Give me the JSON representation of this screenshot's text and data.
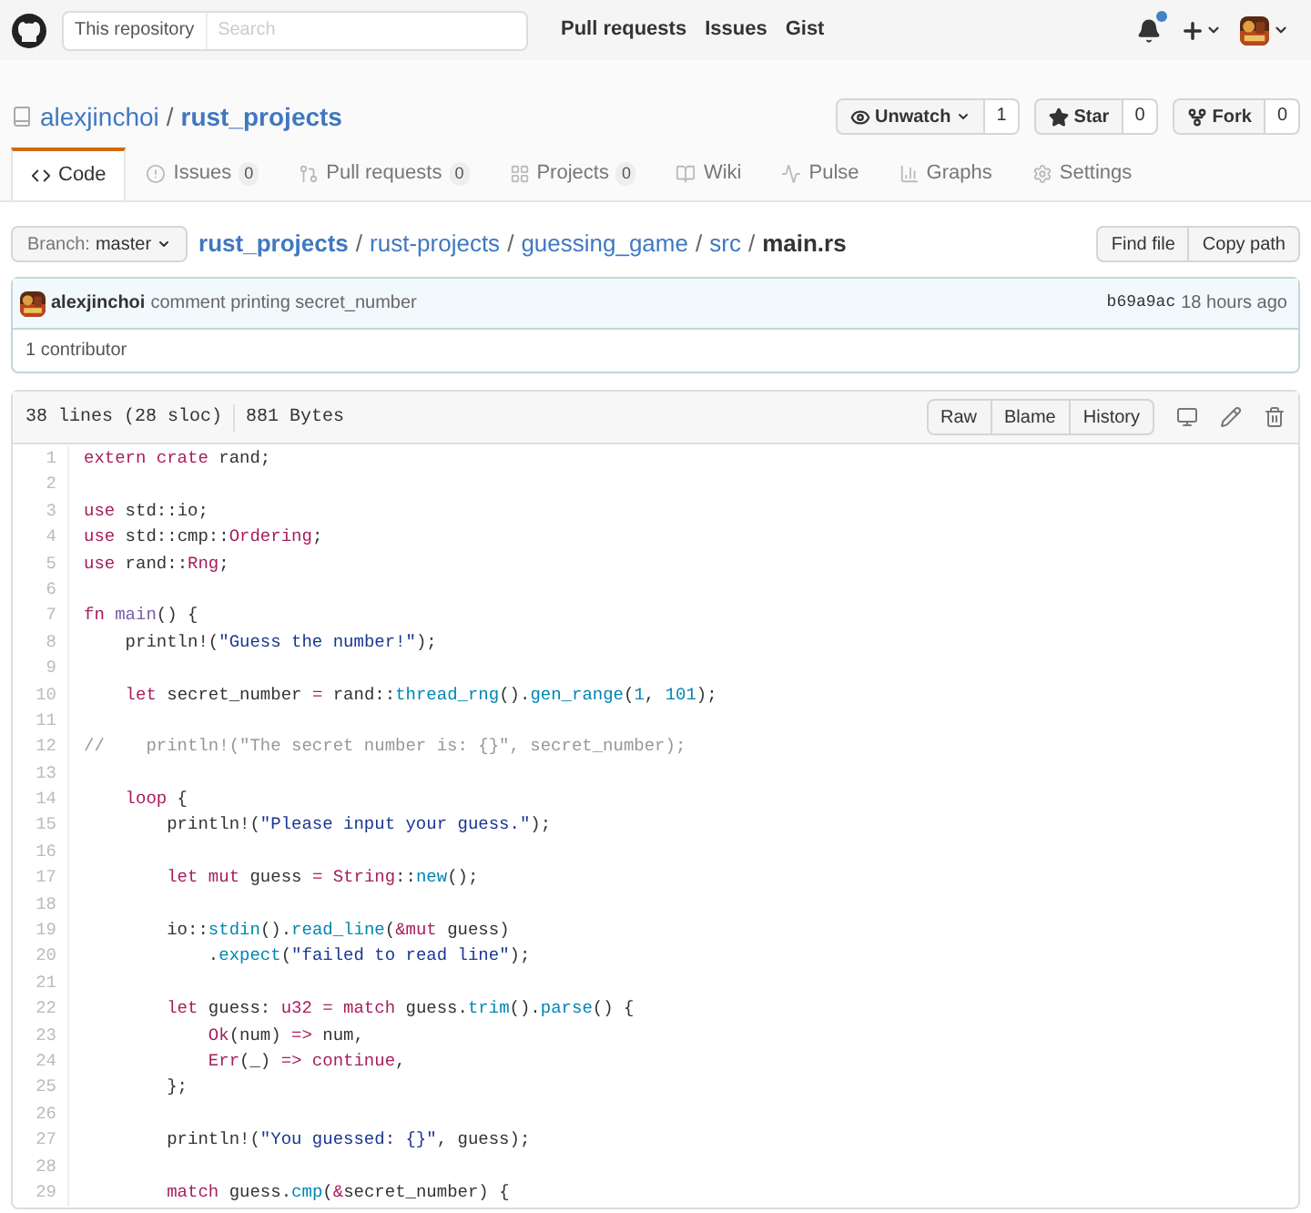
{
  "header": {
    "scope_label": "This repository",
    "search": {
      "placeholder": "Search"
    },
    "nav": [
      "Pull requests",
      "Issues",
      "Gist"
    ],
    "notification_unread": true
  },
  "repo": {
    "owner": "alexjinchoi",
    "separator": "/",
    "name": "rust_projects",
    "actions": [
      {
        "kind": "watch",
        "label": "Unwatch",
        "count": "1"
      },
      {
        "kind": "star",
        "label": "Star",
        "count": "0"
      },
      {
        "kind": "fork",
        "label": "Fork",
        "count": "0"
      }
    ]
  },
  "tabs": [
    {
      "kind": "code",
      "label": "Code",
      "selected": true
    },
    {
      "kind": "issues",
      "label": "Issues",
      "count": "0",
      "selected": false
    },
    {
      "kind": "pulls",
      "label": "Pull requests",
      "count": "0",
      "selected": false
    },
    {
      "kind": "projects",
      "label": "Projects",
      "count": "0",
      "selected": false
    },
    {
      "kind": "wiki",
      "label": "Wiki",
      "selected": false
    },
    {
      "kind": "pulse",
      "label": "Pulse",
      "selected": false
    },
    {
      "kind": "graphs",
      "label": "Graphs",
      "selected": false
    },
    {
      "kind": "settings",
      "label": "Settings",
      "selected": false
    }
  ],
  "branch": {
    "label": "Branch:",
    "value": "master"
  },
  "breadcrumb": [
    "rust_projects",
    "rust-projects",
    "guessing_game",
    "src",
    "main.rs"
  ],
  "breadcrumb_separator": "/",
  "file_actions": [
    "Find file",
    "Copy path"
  ],
  "commit": {
    "author": "alexjinchoi",
    "message": "comment printing secret_number",
    "sha": "b69a9ac",
    "time": "18 hours ago"
  },
  "contributors": "1 contributor",
  "file": {
    "lines_info": "38 lines (28 sloc)",
    "size": "881 Bytes",
    "buttons": [
      "Raw",
      "Blame",
      "History"
    ],
    "lines": [
      {
        "number": "1",
        "segments": [
          {
            "kind": "kw",
            "text": "extern crate"
          },
          {
            "kind": "plain",
            "text": " rand;"
          }
        ]
      },
      {
        "number": "2"
      },
      {
        "number": "3",
        "segments": [
          {
            "kind": "kw",
            "text": "use"
          },
          {
            "kind": "plain",
            "text": " std::io;"
          }
        ]
      },
      {
        "number": "4",
        "segments": [
          {
            "kind": "kw",
            "text": "use"
          },
          {
            "kind": "plain",
            "text": " std::cmp::"
          },
          {
            "kind": "kw",
            "text": "Ordering"
          },
          {
            "kind": "plain",
            "text": ";"
          }
        ]
      },
      {
        "number": "5",
        "segments": [
          {
            "kind": "kw",
            "text": "use"
          },
          {
            "kind": "plain",
            "text": " rand::"
          },
          {
            "kind": "kw",
            "text": "Rng"
          },
          {
            "kind": "plain",
            "text": ";"
          }
        ]
      },
      {
        "number": "6"
      },
      {
        "number": "7",
        "segments": [
          {
            "kind": "kw",
            "text": "fn "
          },
          {
            "kind": "ent",
            "text": "main"
          },
          {
            "kind": "plain",
            "text": "() {"
          }
        ]
      },
      {
        "number": "8",
        "segments": [
          {
            "kind": "plain",
            "text": "    println!("
          },
          {
            "kind": "str",
            "text": "\"Guess the number!\""
          },
          {
            "kind": "plain",
            "text": ");"
          }
        ]
      },
      {
        "number": "9"
      },
      {
        "number": "10",
        "segments": [
          {
            "kind": "kw",
            "text": "    let"
          },
          {
            "kind": "plain",
            "text": " secret_number "
          },
          {
            "kind": "kw",
            "text": "="
          },
          {
            "kind": "plain",
            "text": " rand::"
          },
          {
            "kind": "fn",
            "text": "thread_rng"
          },
          {
            "kind": "plain",
            "text": "()."
          },
          {
            "kind": "fn",
            "text": "gen_range"
          },
          {
            "kind": "plain",
            "text": "("
          },
          {
            "kind": "fn",
            "text": "1"
          },
          {
            "kind": "plain",
            "text": ", "
          },
          {
            "kind": "fn",
            "text": "101"
          },
          {
            "kind": "plain",
            "text": ");"
          }
        ]
      },
      {
        "number": "11"
      },
      {
        "number": "12",
        "segments": [
          {
            "kind": "comment",
            "text": "//    println!(\"The secret number is: {}\", secret_number);"
          }
        ]
      },
      {
        "number": "13"
      },
      {
        "number": "14",
        "segments": [
          {
            "kind": "kw",
            "text": "    loop"
          },
          {
            "kind": "plain",
            "text": " {"
          }
        ]
      },
      {
        "number": "15",
        "segments": [
          {
            "kind": "plain",
            "text": "        println!("
          },
          {
            "kind": "str",
            "text": "\"Please input your guess.\""
          },
          {
            "kind": "plain",
            "text": ");"
          }
        ]
      },
      {
        "number": "16"
      },
      {
        "number": "17",
        "segments": [
          {
            "kind": "kw",
            "text": "        let mut"
          },
          {
            "kind": "plain",
            "text": " guess "
          },
          {
            "kind": "kw",
            "text": "= String"
          },
          {
            "kind": "plain",
            "text": "::"
          },
          {
            "kind": "fn",
            "text": "new"
          },
          {
            "kind": "plain",
            "text": "();"
          }
        ]
      },
      {
        "number": "18"
      },
      {
        "number": "19",
        "segments": [
          {
            "kind": "plain",
            "text": "        io::"
          },
          {
            "kind": "fn",
            "text": "stdin"
          },
          {
            "kind": "plain",
            "text": "()."
          },
          {
            "kind": "fn",
            "text": "read_line"
          },
          {
            "kind": "plain",
            "text": "("
          },
          {
            "kind": "kw",
            "text": "&mut"
          },
          {
            "kind": "plain",
            "text": " guess)"
          }
        ]
      },
      {
        "number": "20",
        "segments": [
          {
            "kind": "plain",
            "text": "            ."
          },
          {
            "kind": "fn",
            "text": "expect"
          },
          {
            "kind": "plain",
            "text": "("
          },
          {
            "kind": "str",
            "text": "\"failed to read line\""
          },
          {
            "kind": "plain",
            "text": ");"
          }
        ]
      },
      {
        "number": "21"
      },
      {
        "number": "22",
        "segments": [
          {
            "kind": "kw",
            "text": "        let"
          },
          {
            "kind": "plain",
            "text": " guess: "
          },
          {
            "kind": "kw",
            "text": "u32 = match"
          },
          {
            "kind": "plain",
            "text": " guess."
          },
          {
            "kind": "fn",
            "text": "trim"
          },
          {
            "kind": "plain",
            "text": "()."
          },
          {
            "kind": "fn",
            "text": "parse"
          },
          {
            "kind": "plain",
            "text": "() {"
          }
        ]
      },
      {
        "number": "23",
        "segments": [
          {
            "kind": "kw",
            "text": "            Ok"
          },
          {
            "kind": "plain",
            "text": "(num) "
          },
          {
            "kind": "kw",
            "text": "=>"
          },
          {
            "kind": "plain",
            "text": " num,"
          }
        ]
      },
      {
        "number": "24",
        "segments": [
          {
            "kind": "kw",
            "text": "            Err"
          },
          {
            "kind": "plain",
            "text": "(_) "
          },
          {
            "kind": "kw",
            "text": "=> continue"
          },
          {
            "kind": "plain",
            "text": ","
          }
        ]
      },
      {
        "number": "25",
        "segments": [
          {
            "kind": "plain",
            "text": "        };"
          }
        ]
      },
      {
        "number": "26"
      },
      {
        "number": "27",
        "segments": [
          {
            "kind": "plain",
            "text": "        println!("
          },
          {
            "kind": "str",
            "text": "\"You guessed: {}\""
          },
          {
            "kind": "plain",
            "text": ", guess);"
          }
        ]
      },
      {
        "number": "28"
      },
      {
        "number": "29",
        "segments": [
          {
            "kind": "kw",
            "text": "        match"
          },
          {
            "kind": "plain",
            "text": " guess."
          },
          {
            "kind": "fn",
            "text": "cmp"
          },
          {
            "kind": "plain",
            "text": "("
          },
          {
            "kind": "kw",
            "text": "&"
          },
          {
            "kind": "plain",
            "text": "secret_number) {"
          }
        ]
      }
    ]
  }
}
